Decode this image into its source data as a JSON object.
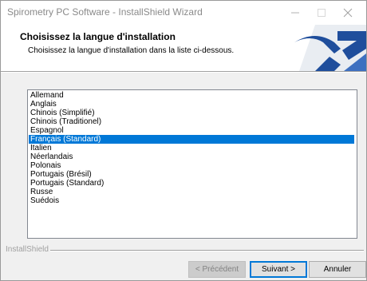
{
  "window": {
    "title": "Spirometry PC Software - InstallShield Wizard"
  },
  "header": {
    "title": "Choisissez la langue d'installation",
    "subtitle": "Choisissez la langue d'installation dans la liste ci-dessous."
  },
  "languages": {
    "items": [
      {
        "label": "Allemand"
      },
      {
        "label": "Anglais"
      },
      {
        "label": "Chinois (Simplifié)"
      },
      {
        "label": "Chinois (Traditionel)"
      },
      {
        "label": "Espagnol"
      },
      {
        "label": "Français (Standard)"
      },
      {
        "label": "Italien"
      },
      {
        "label": "Néerlandais"
      },
      {
        "label": "Polonais"
      },
      {
        "label": "Portugais (Brésil)"
      },
      {
        "label": "Portugais (Standard)"
      },
      {
        "label": "Russe"
      },
      {
        "label": "Suédois"
      }
    ],
    "selected": "Français (Standard)"
  },
  "footer": {
    "brand": "InstallShield"
  },
  "buttons": {
    "back": "< Précédent",
    "next": "Suivant >",
    "cancel": "Annuler"
  },
  "colors": {
    "selection": "#0078d7",
    "logo_blue": "#1f4e9c"
  },
  "icons": [
    "minimize-icon",
    "maximize-icon",
    "close-icon",
    "installshield-logo-icon"
  ]
}
